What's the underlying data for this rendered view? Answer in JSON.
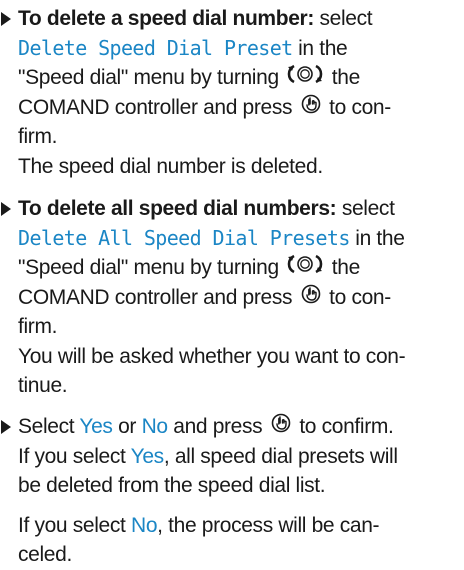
{
  "steps": [
    {
      "lead_bold": "To delete a speed dial number:",
      "select_word": "select",
      "ui_item": "Delete Speed Dial Preset",
      "in_the": "in the",
      "menu_text": "\"Speed dial\" menu by turning",
      "the_word": "the",
      "controller_text": "COMAND controller and press",
      "to_con": "to con-",
      "firm": "firm.",
      "result": "The speed dial number is deleted."
    },
    {
      "lead_bold": "To delete all speed dial numbers:",
      "select_word": "select",
      "ui_item": "Delete All Speed Dial Presets",
      "in_the": "in the",
      "menu_text": "\"Speed dial\" menu by turning",
      "the_word": "the",
      "controller_text": "COMAND controller and press",
      "to_con": "to con-",
      "firm": "firm.",
      "result_line1": "You will be asked whether you want to con-",
      "result_line2": "tinue."
    },
    {
      "select_word": "Select",
      "yes": "Yes",
      "or": "or",
      "no": "No",
      "and_press": "and press",
      "to_confirm": "to confirm.",
      "if_you_select": "If you select",
      "yes_comma": ", all speed dial presets will",
      "deleted_line": "be deleted from the speed dial list.",
      "if_no_prefix": "If you select",
      "if_no_suffix": ", the process will be can-",
      "canceled": "celed."
    }
  ],
  "icons": {
    "rotate": "controller-rotate-icon",
    "press": "controller-press-icon"
  },
  "colors": {
    "ui_text": "#1b86c5",
    "body_text": "#1a1a1a"
  }
}
